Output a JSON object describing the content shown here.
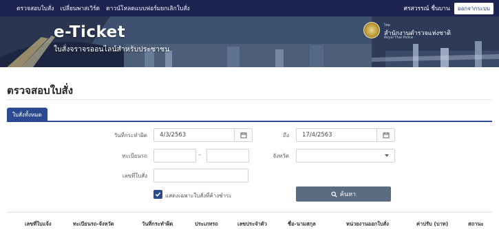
{
  "topbar": {
    "nav": [
      "ตรวจสอบใบสั่ง",
      "เปลี่ยนพาสเวิร์ด",
      "ดาวน์โหลดแบบฟอร์มยกเลิกใบสั่ง"
    ],
    "user_name": "ศรสวรรณ์ ชื่นบาน",
    "logout_label": "ออกจากระบบ"
  },
  "banner": {
    "brand": "e-Ticket",
    "tagline": "ใบสั่งจราจรออนไลน์สำหรับประชาชน",
    "agency_sub": "ไทย",
    "agency": "สำนักงานตำรวจแห่งชาติ",
    "agency_en": "Royal Thai Police"
  },
  "page_title": "ตรวจสอบใบสั่ง",
  "tab_label": "ใบสั่งทั้งหมด",
  "form": {
    "date_from_label": "วันที่กระทำผิด",
    "date_from_value": "4/3/2563",
    "date_to_label": "ถึง",
    "date_to_value": "17/4/2563",
    "plate_label": "ทะเบียนรถ",
    "plate_part1": "",
    "plate_dash": "-",
    "plate_part2": "",
    "province_label": "จังหวัด",
    "province_value": "",
    "ticket_no_label": "เลขที่ใบสั่ง",
    "ticket_no_value": "",
    "unpaid_only_label": "แสดงเฉพาะใบสั่งที่ค้างชำระ",
    "unpaid_only_checked": true,
    "search_label": "ค้นหา"
  },
  "table": {
    "headers": [
      "เลขที่ใบแจ้ง",
      "ทะเบียนรถ-จังหวัด",
      "วันที่กระทำผิด",
      "ประเภทรถ",
      "เลขประจำตัว",
      "ชื่อ-นามสกุล",
      "หน่วยงานออกใบสั่ง",
      "ค่าปรับ (บาท)",
      "สถานะ"
    ]
  },
  "colors": {
    "topbar": "#1d2450",
    "accent": "#2b4a8f",
    "search_button": "#5b6b80"
  }
}
